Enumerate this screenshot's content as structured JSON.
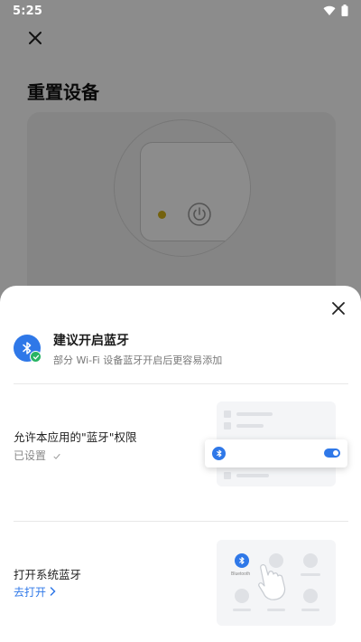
{
  "status_bar": {
    "time": "5:25",
    "icons": [
      "wifi-icon",
      "battery-icon"
    ]
  },
  "background_page": {
    "title": "重置设备",
    "close_icon": "close-icon"
  },
  "sheet": {
    "title": "建议开启蓝牙",
    "subtitle": "部分 Wi-Fi 设备蓝牙开启后更容易添加",
    "close_icon": "close-icon",
    "steps": [
      {
        "label": "允许本应用的\"蓝牙\"权限",
        "status": "已设置",
        "status_icon": "check-icon"
      },
      {
        "label": "打开系统蓝牙",
        "action": "去打开",
        "action_icon": "chevron-right-icon",
        "illustration_text": "Bluetooth"
      }
    ]
  },
  "colors": {
    "accent": "#2f78e8",
    "success": "#28b463",
    "led": "#d4b21a",
    "scrim": "rgba(0,0,0,0.45)"
  }
}
